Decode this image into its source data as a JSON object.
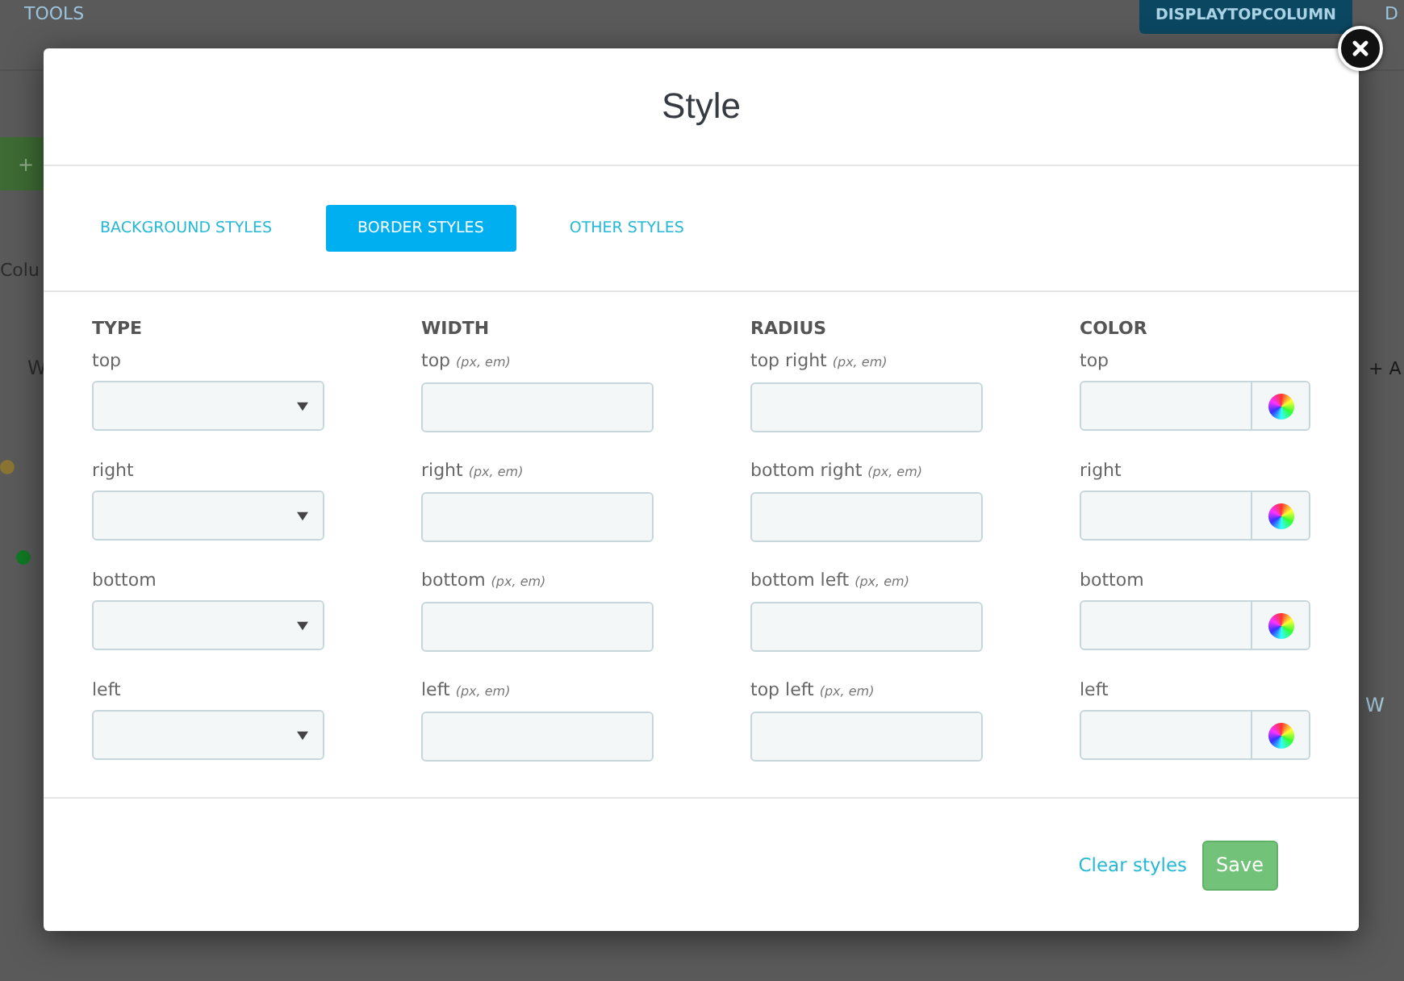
{
  "background": {
    "menu_link": "TOOLS",
    "hook_button": "DISPLAYTOPCOLUMN",
    "cut_tab": "D",
    "add_button": "+",
    "column_label": "Colu",
    "row_label": "W",
    "add_link": "+ A",
    "side_link": "W",
    "status_dots": [
      {
        "color": "#8a7434"
      },
      {
        "color": "#0f7a23"
      }
    ]
  },
  "modal": {
    "title": "Style",
    "tabs": [
      {
        "label": "BACKGROUND STYLES",
        "selected": false
      },
      {
        "label": "BORDER STYLES",
        "selected": true
      },
      {
        "label": "OTHER STYLES",
        "selected": false
      }
    ],
    "columns": [
      {
        "heading": "TYPE",
        "kind": "select",
        "fields": [
          {
            "label": "top"
          },
          {
            "label": "right"
          },
          {
            "label": "bottom"
          },
          {
            "label": "left"
          }
        ]
      },
      {
        "heading": "WIDTH",
        "kind": "text",
        "fields": [
          {
            "label": "top",
            "hint": "(px, em)"
          },
          {
            "label": "right",
            "hint": "(px, em)"
          },
          {
            "label": "bottom",
            "hint": "(px, em)"
          },
          {
            "label": "left",
            "hint": "(px, em)"
          }
        ]
      },
      {
        "heading": "RADIUS",
        "kind": "text",
        "fields": [
          {
            "label": "top right",
            "hint": "(px, em)"
          },
          {
            "label": "bottom right",
            "hint": "(px, em)"
          },
          {
            "label": "bottom left",
            "hint": "(px, em)"
          },
          {
            "label": "top left",
            "hint": "(px, em)"
          }
        ]
      },
      {
        "heading": "COLOR",
        "kind": "color",
        "fields": [
          {
            "label": "top"
          },
          {
            "label": "right"
          },
          {
            "label": "bottom"
          },
          {
            "label": "left"
          }
        ]
      }
    ],
    "footer": {
      "clear_link": "Clear styles",
      "save_button": "Save"
    }
  }
}
